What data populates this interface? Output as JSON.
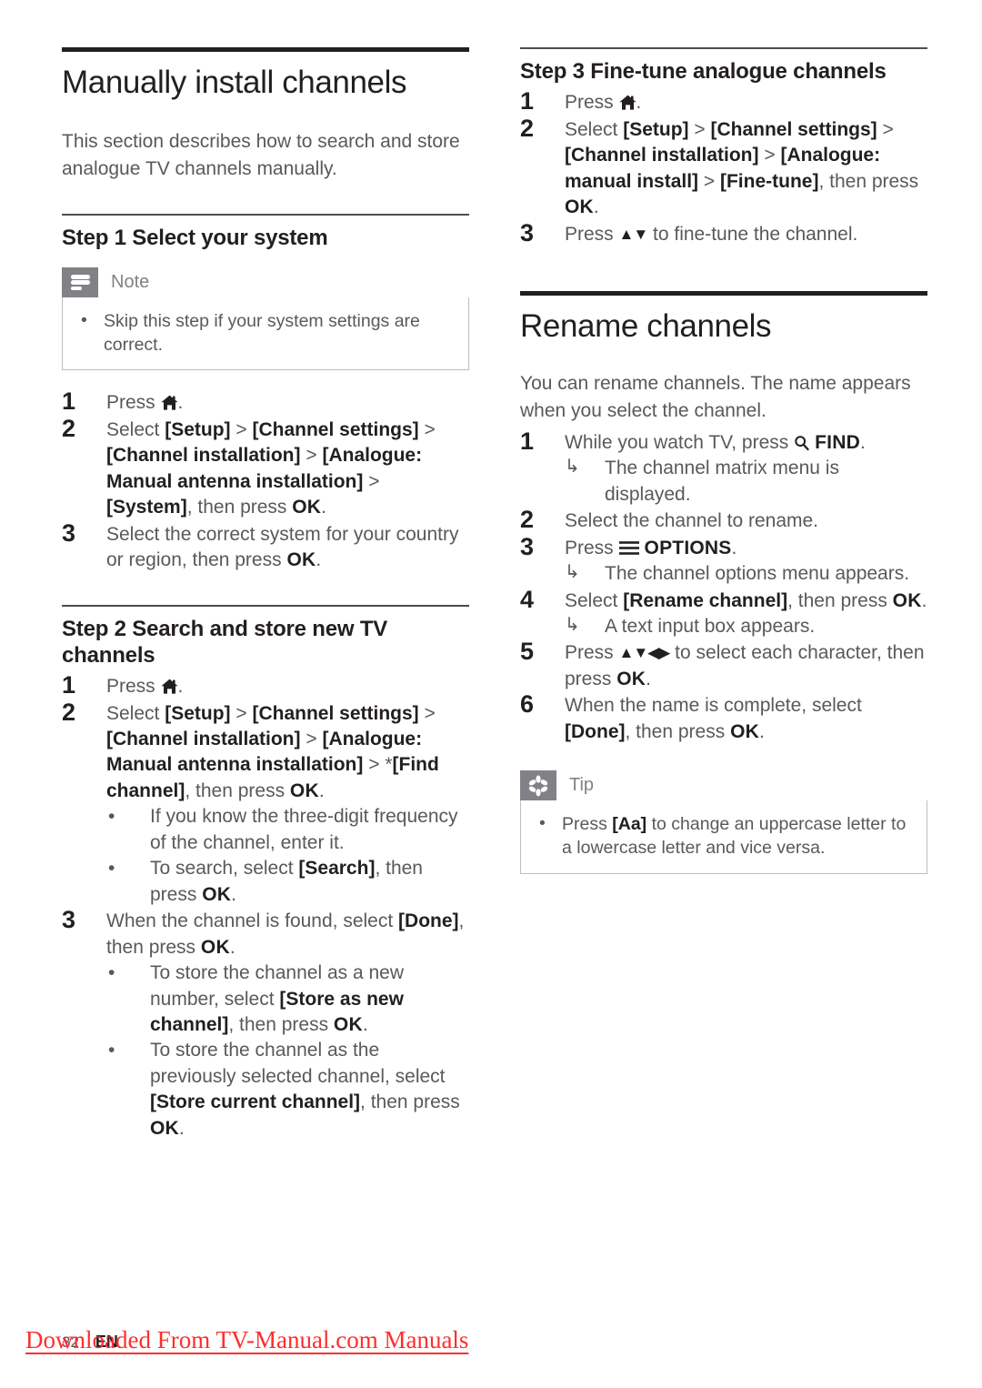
{
  "document": {
    "page_number": "32",
    "language_code": "EN",
    "watermark": "Downloaded From TV-Manual.com Manuals",
    "watermark_color": "#ff2d2d"
  },
  "icons": {
    "home": "home-icon",
    "search": "search-icon",
    "options": "hamburger-menu-icon",
    "note": "note-lines-icon",
    "tip": "asterisk-star-icon",
    "up_down": "▲▼",
    "up_down_left_right": "▲▼◀▶",
    "arrow_result": "↳",
    "bullet": "•"
  },
  "left_column": {
    "chapter_title": "Manually install channels",
    "intro": "This section describes how to search and store analogue TV channels manually.",
    "step1": {
      "heading": "Step 1 Select your system",
      "note": {
        "label": "Note",
        "items": [
          "Skip this step if your system settings are correct."
        ]
      },
      "items": [
        {
          "num": "1",
          "parts": [
            {
              "t": "Press ",
              "s": "plain"
            },
            {
              "t": "home-icon",
              "s": "icon-home"
            },
            {
              "t": ".",
              "s": "plain"
            }
          ]
        },
        {
          "num": "2",
          "parts": [
            {
              "t": "Select ",
              "s": "plain"
            },
            {
              "t": "[Setup]",
              "s": "bold"
            },
            {
              "t": " > ",
              "s": "plain"
            },
            {
              "t": "[Channel settings]",
              "s": "bold"
            },
            {
              "t": " > ",
              "s": "plain"
            },
            {
              "t": "[Channel installation]",
              "s": "bold"
            },
            {
              "t": " > ",
              "s": "plain"
            },
            {
              "t": "[Analogue: Manual antenna installation]",
              "s": "bold"
            },
            {
              "t": " > ",
              "s": "plain"
            },
            {
              "t": "[System]",
              "s": "bold"
            },
            {
              "t": ", then press ",
              "s": "plain"
            },
            {
              "t": "OK",
              "s": "ok"
            },
            {
              "t": ".",
              "s": "plain"
            }
          ]
        },
        {
          "num": "3",
          "parts": [
            {
              "t": "Select the correct system for your country or region, then press ",
              "s": "plain"
            },
            {
              "t": "OK",
              "s": "ok"
            },
            {
              "t": ".",
              "s": "plain"
            }
          ]
        }
      ]
    },
    "step2": {
      "heading": "Step 2 Search and store new TV channels",
      "items": [
        {
          "num": "1",
          "parts": [
            {
              "t": "Press ",
              "s": "plain"
            },
            {
              "t": "home-icon",
              "s": "icon-home"
            },
            {
              "t": ".",
              "s": "plain"
            }
          ]
        },
        {
          "num": "2",
          "parts": [
            {
              "t": "Select ",
              "s": "plain"
            },
            {
              "t": "[Setup]",
              "s": "bold"
            },
            {
              "t": " > ",
              "s": "plain"
            },
            {
              "t": "[Channel settings]",
              "s": "bold"
            },
            {
              "t": " > ",
              "s": "plain"
            },
            {
              "t": "[Channel installation]",
              "s": "bold"
            },
            {
              "t": " > ",
              "s": "plain"
            },
            {
              "t": "[Analogue: Manual antenna installation]",
              "s": "bold"
            },
            {
              "t": " > ",
              "s": "plain"
            },
            {
              "t": "*[Find channel]",
              "s": "mixed-find"
            },
            {
              "t": ", then press ",
              "s": "plain"
            },
            {
              "t": "OK",
              "s": "ok"
            },
            {
              "t": ".",
              "s": "plain"
            }
          ],
          "bullets": [
            [
              {
                "t": "If you know the three-digit frequency of the channel, enter it.",
                "s": "plain"
              }
            ],
            [
              {
                "t": "To search, select ",
                "s": "plain"
              },
              {
                "t": "[Search]",
                "s": "bold"
              },
              {
                "t": ", then press ",
                "s": "plain"
              },
              {
                "t": "OK",
                "s": "ok"
              },
              {
                "t": ".",
                "s": "plain"
              }
            ]
          ]
        },
        {
          "num": "3",
          "parts": [
            {
              "t": "When the channel is found, select ",
              "s": "plain"
            },
            {
              "t": "[Done]",
              "s": "bold"
            },
            {
              "t": ", then press ",
              "s": "plain"
            },
            {
              "t": "OK",
              "s": "ok"
            },
            {
              "t": ".",
              "s": "plain"
            }
          ],
          "bullets": [
            [
              {
                "t": "To store the channel as a new number, select ",
                "s": "plain"
              },
              {
                "t": "[Store as new channel]",
                "s": "bold"
              },
              {
                "t": ", then press ",
                "s": "plain"
              },
              {
                "t": "OK",
                "s": "ok"
              },
              {
                "t": ".",
                "s": "plain"
              }
            ],
            [
              {
                "t": "To store the channel as the previously selected channel, select ",
                "s": "plain"
              },
              {
                "t": "[Store current channel]",
                "s": "bold"
              },
              {
                "t": ", then press ",
                "s": "plain"
              },
              {
                "t": "OK",
                "s": "ok"
              },
              {
                "t": ".",
                "s": "plain"
              }
            ]
          ]
        }
      ]
    }
  },
  "right_column": {
    "step3": {
      "heading": "Step 3 Fine-tune analogue channels",
      "items": [
        {
          "num": "1",
          "parts": [
            {
              "t": "Press ",
              "s": "plain"
            },
            {
              "t": "home-icon",
              "s": "icon-home"
            },
            {
              "t": ".",
              "s": "plain"
            }
          ]
        },
        {
          "num": "2",
          "parts": [
            {
              "t": "Select ",
              "s": "plain"
            },
            {
              "t": "[Setup]",
              "s": "bold"
            },
            {
              "t": " > ",
              "s": "plain"
            },
            {
              "t": "[Channel settings]",
              "s": "bold"
            },
            {
              "t": " > ",
              "s": "plain"
            },
            {
              "t": "[Channel installation]",
              "s": "bold"
            },
            {
              "t": " > ",
              "s": "plain"
            },
            {
              "t": "[Analogue: manual install]",
              "s": "bold"
            },
            {
              "t": " > ",
              "s": "plain"
            },
            {
              "t": "[Fine-tune]",
              "s": "bold"
            },
            {
              "t": ", then press ",
              "s": "plain"
            },
            {
              "t": "OK",
              "s": "ok"
            },
            {
              "t": ".",
              "s": "plain"
            }
          ]
        },
        {
          "num": "3",
          "parts": [
            {
              "t": "Press ",
              "s": "plain"
            },
            {
              "t": "▲▼",
              "s": "arrows"
            },
            {
              "t": " to fine-tune the channel.",
              "s": "plain"
            }
          ]
        }
      ]
    },
    "rename": {
      "chapter_title": "Rename channels",
      "intro": "You can rename channels. The name appears when you select the channel.",
      "items": [
        {
          "num": "1",
          "parts": [
            {
              "t": "While you watch TV, press ",
              "s": "plain"
            },
            {
              "t": "search-icon",
              "s": "icon-search"
            },
            {
              "t": " FIND",
              "s": "ok"
            },
            {
              "t": ".",
              "s": "plain"
            }
          ],
          "results": [
            "The channel matrix menu is displayed."
          ]
        },
        {
          "num": "2",
          "parts": [
            {
              "t": "Select the channel to rename.",
              "s": "plain"
            }
          ]
        },
        {
          "num": "3",
          "parts": [
            {
              "t": "Press ",
              "s": "plain"
            },
            {
              "t": "hamburger-menu-icon",
              "s": "icon-burger"
            },
            {
              "t": " OPTIONS",
              "s": "ok"
            },
            {
              "t": ".",
              "s": "plain"
            }
          ],
          "results": [
            "The channel options menu appears."
          ]
        },
        {
          "num": "4",
          "parts": [
            {
              "t": "Select ",
              "s": "plain"
            },
            {
              "t": "[Rename channel]",
              "s": "bold"
            },
            {
              "t": ", then press ",
              "s": "plain"
            },
            {
              "t": "OK",
              "s": "ok"
            },
            {
              "t": ".",
              "s": "plain"
            }
          ],
          "results": [
            "A text input box appears."
          ]
        },
        {
          "num": "5",
          "parts": [
            {
              "t": "Press ",
              "s": "plain"
            },
            {
              "t": "▲▼◀▶",
              "s": "arrows"
            },
            {
              "t": " to select each character, then press ",
              "s": "plain"
            },
            {
              "t": "OK",
              "s": "ok"
            },
            {
              "t": ".",
              "s": "plain"
            }
          ]
        },
        {
          "num": "6",
          "parts": [
            {
              "t": "When the name is complete, select ",
              "s": "plain"
            },
            {
              "t": "[Done]",
              "s": "bold"
            },
            {
              "t": ", then press ",
              "s": "plain"
            },
            {
              "t": "OK",
              "s": "ok"
            },
            {
              "t": ".",
              "s": "plain"
            }
          ]
        }
      ],
      "tip": {
        "label": "Tip",
        "items_parts": [
          [
            {
              "t": "Press ",
              "s": "plain"
            },
            {
              "t": "[Aa]",
              "s": "bold"
            },
            {
              "t": " to change an uppercase letter to a lowercase letter and vice versa.",
              "s": "plain"
            }
          ]
        ]
      }
    }
  }
}
